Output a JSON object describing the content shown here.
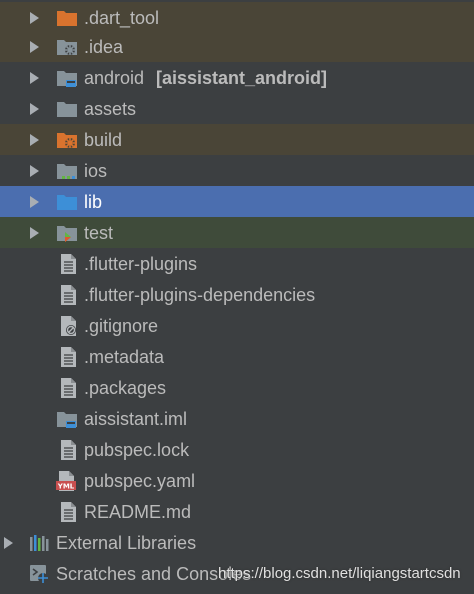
{
  "tree": {
    "items": [
      {
        "label": "",
        "text": ".dart_tool",
        "icon": "folder-orange-icon"
      },
      {
        "text": ".idea",
        "icon": "folder-idea-icon"
      },
      {
        "text": "android",
        "suffix": "[aissistant_android]",
        "icon": "folder-module-icon"
      },
      {
        "text": "assets",
        "icon": "folder-icon"
      },
      {
        "text": "build",
        "icon": "folder-excluded-icon"
      },
      {
        "text": "ios",
        "icon": "folder-ios-icon"
      },
      {
        "text": "lib",
        "icon": "folder-source-icon"
      },
      {
        "text": "test",
        "icon": "folder-test-icon"
      },
      {
        "text": ".flutter-plugins",
        "icon": "file-icon"
      },
      {
        "text": ".flutter-plugins-dependencies",
        "icon": "file-icon"
      },
      {
        "text": ".gitignore",
        "icon": "file-ignore-icon"
      },
      {
        "text": ".metadata",
        "icon": "file-icon"
      },
      {
        "text": ".packages",
        "icon": "file-icon"
      },
      {
        "text": "aissistant.iml",
        "icon": "module-file-icon"
      },
      {
        "text": "pubspec.lock",
        "icon": "file-icon"
      },
      {
        "text": "pubspec.yaml",
        "icon": "yaml-file-icon"
      },
      {
        "text": "README.md",
        "icon": "file-icon"
      },
      {
        "text": "External Libraries",
        "icon": "libraries-icon"
      },
      {
        "text": "Scratches and Consoles",
        "icon": "scratches-icon"
      }
    ]
  },
  "watermark": "https://blog.csdn.net/liqiangstartcsdn",
  "colors": {
    "background": "#3c3f41",
    "excluded_row": "#4a4537",
    "selected_row": "#4b6eaf",
    "test_row": "#3f4b3a",
    "folder": "#87939a",
    "folder_orange": "#d9732e",
    "source_folder": "#3d8fd7"
  }
}
